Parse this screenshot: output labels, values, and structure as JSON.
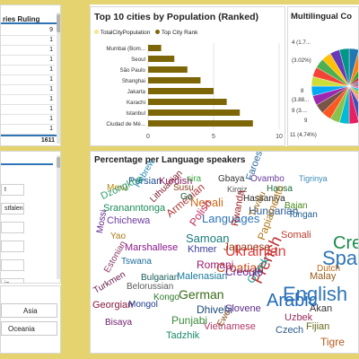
{
  "colors": {
    "gold": "#e4d36e",
    "olive": "#7d6608",
    "light_gold": "#f5e58c",
    "accent_blue": "#2e75b6"
  },
  "table_panel": {
    "header": "ries Ruling",
    "values": [
      "9",
      "1",
      "1",
      "1",
      "1",
      "1",
      "1",
      "1",
      "1",
      "1",
      "1"
    ],
    "total": "1611"
  },
  "slicer_panel": {
    "items": [
      "t",
      "stfalen",
      "",
      "",
      "",
      "ia",
      ""
    ]
  },
  "continent_panel": {
    "buttons": [
      "Asia",
      "Oceania"
    ]
  },
  "bar_chart": {
    "title": "Top 10 cities by Population (Ranked)",
    "legend": [
      "TotalCityPopulation",
      "Top City Rank"
    ]
  },
  "chart_data": {
    "type": "bar",
    "title": "Top 10 cities by Population (Ranked)",
    "categories": [
      "Mumbai (Bom...",
      "Seoul",
      "São Paulo",
      "Shanghai",
      "Jakarta",
      "Karachi",
      "Istanbul",
      "Ciudad de Mé..."
    ],
    "series": [
      {
        "name": "TotalCityPopulation",
        "values": [
          0,
          0,
          0,
          0,
          0,
          0,
          0,
          0
        ]
      },
      {
        "name": "Top City Rank",
        "values": [
          1,
          2,
          3,
          4,
          5,
          6,
          7,
          8
        ]
      }
    ],
    "xlim": [
      0,
      10
    ],
    "xticks": [
      "0",
      "5",
      "10"
    ]
  },
  "pie_chart": {
    "title": "Multilingual Co",
    "labels": [
      "4 (1.7...",
      "(3.02%)",
      "8",
      "(3.88...",
      "9 (3....",
      "9",
      "11 (4.74%)"
    ],
    "slice_colors": [
      "#1f77b4",
      "#ff7f0e",
      "#2ca02c",
      "#d62728",
      "#9467bd",
      "#8c564b",
      "#e377c2",
      "#17becf",
      "#bcbd22",
      "#ff9896",
      "#3f51b5",
      "#e91e63",
      "#00bcd4",
      "#8bc34a",
      "#ff5722",
      "#795548",
      "#9c27b0",
      "#03a9f4",
      "#cddc39",
      "#f44336",
      "#4caf50",
      "#ffc107",
      "#673ab7",
      "#009688"
    ]
  },
  "word_cloud": {
    "title": "Percentage per Language speakers",
    "words": [
      {
        "t": "Persian",
        "c": "#1a4f8a"
      },
      {
        "t": "Kurdish",
        "c": "#8a1a5a"
      },
      {
        "t": "sira",
        "c": "#38a840"
      },
      {
        "t": "Gbaya",
        "c": "#333"
      },
      {
        "t": "Ovambo",
        "c": "#6a3a9a"
      },
      {
        "t": "Tigrinya",
        "c": "#3a8ab8"
      },
      {
        "t": "Meru",
        "c": "#b8860b"
      },
      {
        "t": "Hebrew",
        "c": "#1f8ab8"
      },
      {
        "t": "Susu",
        "c": "#8a3a1a"
      },
      {
        "t": "Kirgiz",
        "c": "#555"
      },
      {
        "t": "Hausa",
        "c": "#1a6a3a"
      },
      {
        "t": "Dzongkha",
        "c": "#2e9a6a"
      },
      {
        "t": "Lithuanian",
        "c": "#7a1a2a"
      },
      {
        "t": "Nepali",
        "c": "#d06a1a"
      },
      {
        "t": "Hassaniya",
        "c": "#222"
      },
      {
        "t": "Srananntonga",
        "c": "#1a8a5a"
      },
      {
        "t": "Armenian",
        "c": "#b03a3a"
      },
      {
        "t": "Languages",
        "c": "#2e75b6"
      },
      {
        "t": "Hungarian",
        "c": "#2a5a9a"
      },
      {
        "t": "Chichewa",
        "c": "#6a3aa0"
      },
      {
        "t": "Polish",
        "c": "#c03060"
      },
      {
        "t": "Samoan",
        "c": "#1a7a7a"
      },
      {
        "t": "Tongan",
        "c": "#1a5a8a"
      },
      {
        "t": "Yao",
        "c": "#a87a1a"
      },
      {
        "t": "Mossi",
        "c": "#5a1a8a"
      },
      {
        "t": "Marshallese",
        "c": "#8a1a8a"
      },
      {
        "t": "Khmer",
        "c": "#3a3a9a"
      },
      {
        "t": "Ukrainian",
        "c": "#e03a3a"
      },
      {
        "t": "Somali",
        "c": "#c03a2a"
      },
      {
        "t": "Tswana",
        "c": "#1a6a9a"
      },
      {
        "t": "Rwanda",
        "c": "#9a1a1a"
      },
      {
        "t": "Croatian",
        "c": "#c04a1a"
      },
      {
        "t": "Spa",
        "c": "#2e75b6"
      },
      {
        "t": "Estonian",
        "c": "#8a3a6a"
      },
      {
        "t": "Bulgarian",
        "c": "#1a5a5a"
      },
      {
        "t": "Japanese",
        "c": "#9a3a1a"
      },
      {
        "t": "Papiamento",
        "c": "#b07a1a"
      },
      {
        "t": "Cre",
        "c": "#1a8a4a"
      },
      {
        "t": "Turkmen",
        "c": "#6a1a4a"
      },
      {
        "t": "Malenasian",
        "c": "#1a7a9a"
      },
      {
        "t": "German",
        "c": "#3a6a1a"
      },
      {
        "t": "English",
        "c": "#2e75b6"
      },
      {
        "t": "Georgian",
        "c": "#8a1a3a"
      },
      {
        "t": "Dhivehi",
        "c": "#1a4a7a"
      },
      {
        "t": "French",
        "c": "#c03030"
      },
      {
        "t": "Arabic",
        "c": "#1f6ab8"
      },
      {
        "t": "Malay",
        "c": "#9a5a1a"
      },
      {
        "t": "Dutch",
        "c": "#c06a1a"
      },
      {
        "t": "Kongo",
        "c": "#2a7a2a"
      },
      {
        "t": "Slovene",
        "c": "#5a2a8a"
      },
      {
        "t": "Greek",
        "c": "#1a9a9a"
      },
      {
        "t": "Uzbek",
        "c": "#9a2a5a"
      },
      {
        "t": "Punjabi",
        "c": "#3a8a3a"
      },
      {
        "t": "Vietnamese",
        "c": "#b03a6a"
      },
      {
        "t": "Czech",
        "c": "#2a5a8a"
      },
      {
        "t": "Fijian",
        "c": "#6a6a1a"
      },
      {
        "t": "Akan",
        "c": "#333"
      },
      {
        "t": "Tadzhik",
        "c": "#1a8a6a"
      },
      {
        "t": "Ewe",
        "c": "#8a4a1a"
      },
      {
        "t": "Tigre",
        "c": "#b85a1a"
      },
      {
        "t": "Bisaya",
        "c": "#6a1a6a"
      },
      {
        "t": "Mongol",
        "c": "#1a3a8a"
      },
      {
        "t": "Belorussian",
        "c": "#5a5a5a"
      },
      {
        "t": "Faroese",
        "c": "#2a6a9a"
      },
      {
        "t": "Tuvalu",
        "c": "#9a6a1a"
      },
      {
        "t": "Bajan",
        "c": "#4a8a1a"
      },
      {
        "t": "Creoulo",
        "c": "#6a1a9a"
      },
      {
        "t": "Romani",
        "c": "#9a1a6a"
      },
      {
        "t": "Ga",
        "c": "#1a5a3a"
      }
    ]
  }
}
